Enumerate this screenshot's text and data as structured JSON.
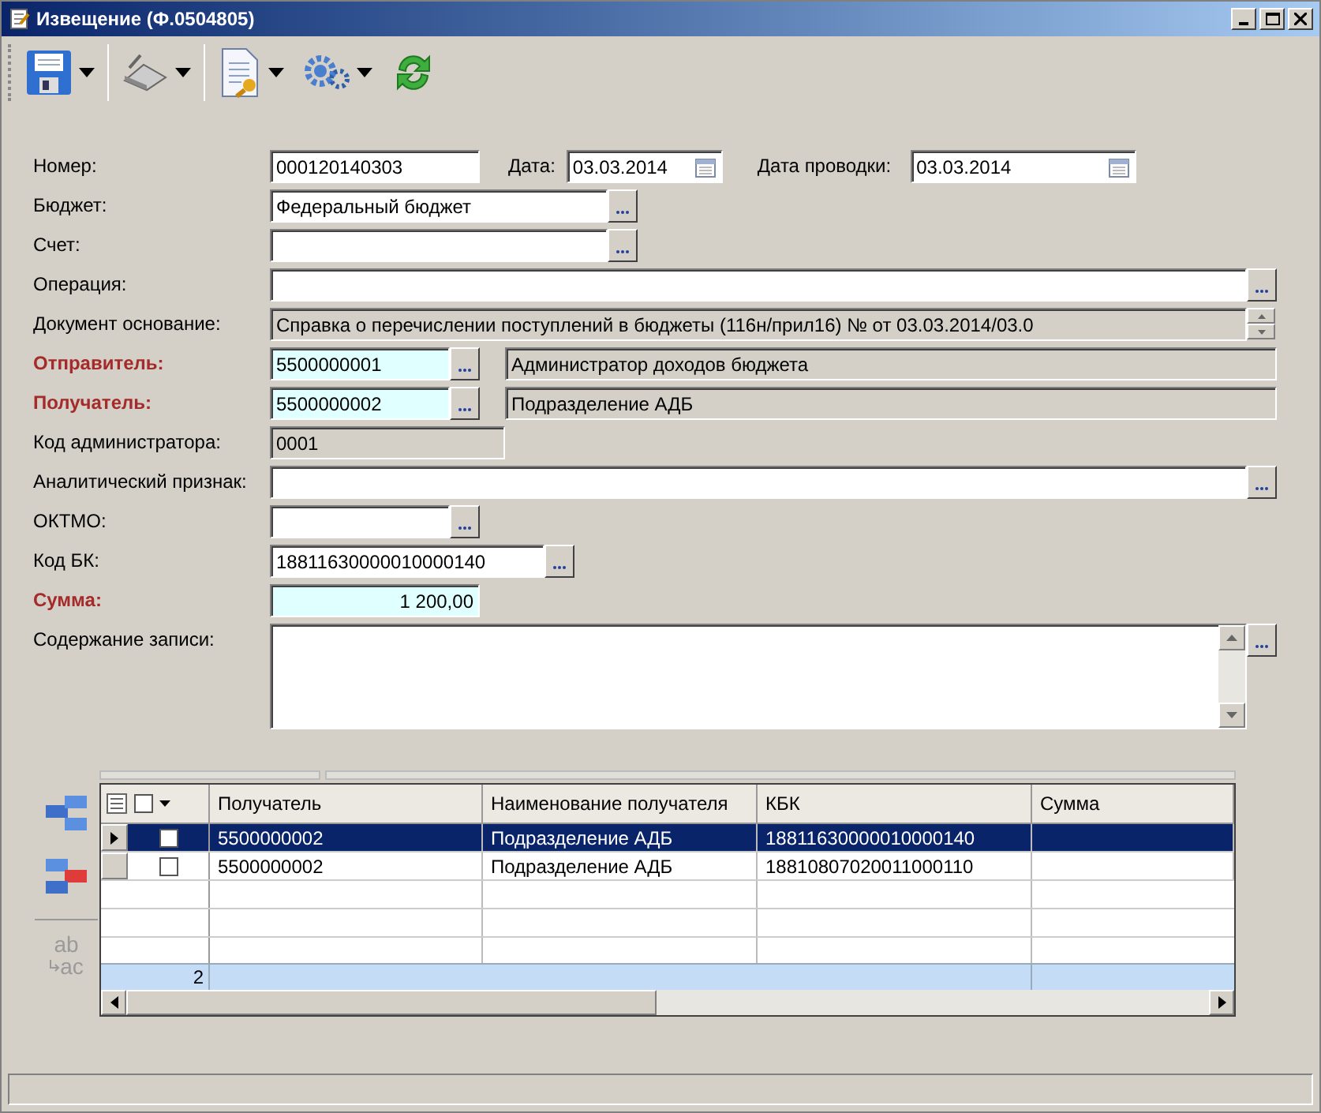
{
  "window": {
    "title": "Извещение (Ф.0504805)"
  },
  "form": {
    "rows": [
      {
        "kind": "short",
        "label": "Номер:",
        "required": false,
        "value": "000120140303",
        "dates": [
          {
            "label": "Дата:",
            "value": "03.03.2014"
          },
          {
            "label": "Дата проводки:",
            "value": "03.03.2014"
          }
        ]
      },
      {
        "kind": "lookup",
        "label": "Бюджет:",
        "required": false,
        "value": "Федеральный бюджет"
      },
      {
        "kind": "lookup",
        "label": "Счет:",
        "required": false
      },
      {
        "kind": "wide",
        "label": "Операция:",
        "required": false
      },
      {
        "kind": "basis",
        "label": "Документ основание:",
        "required": false,
        "value": "Справка о перечислении поступлений в бюджеты (116н/прил16) №  от 03.03.2014/03.0"
      },
      {
        "kind": "party",
        "label": "Отправитель:",
        "required": true,
        "value": "5500000001",
        "name": "Администратор доходов бюджета"
      },
      {
        "kind": "party",
        "label": "Получатель:",
        "required": true,
        "value": "5500000002",
        "name": "Подразделение АДБ"
      },
      {
        "kind": "readonly",
        "label": "Код администратора:",
        "required": false,
        "value": "0001"
      },
      {
        "kind": "wide",
        "label": "Аналитический признак:",
        "required": false
      },
      {
        "kind": "lookup_short",
        "label": "ОКТМО:",
        "required": false
      },
      {
        "kind": "lookup_long",
        "label": "Код БК:",
        "required": false,
        "value": "18811630000010000140"
      },
      {
        "kind": "sum",
        "label": "Сумма:",
        "required": true,
        "value": "1 200,00"
      },
      {
        "kind": "memo",
        "label": "Содержание записи:",
        "required": false
      }
    ]
  },
  "grid": {
    "columns": [
      "Получатель",
      "Наименование получателя",
      "КБК",
      "Сумма"
    ],
    "rows": [
      {
        "selected": true,
        "checked": false,
        "cells": [
          "5500000002",
          "Подразделение АДБ",
          "18811630000010000140"
        ]
      },
      {
        "selected": false,
        "checked": false,
        "cells": [
          "5500000002",
          "Подразделение АДБ",
          "18810807020011000110"
        ]
      }
    ],
    "all_checked": false,
    "footer_count": "2",
    "replace_tool": {
      "top": "ab",
      "bottom": "ac",
      "disabled": true
    }
  }
}
